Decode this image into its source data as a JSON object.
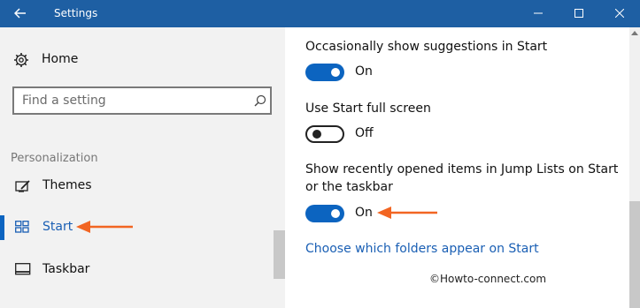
{
  "window": {
    "title": "Settings"
  },
  "nav": {
    "home_label": "Home",
    "search_placeholder": "Find a setting",
    "section_label": "Personalization",
    "items": [
      {
        "label": "Themes",
        "icon": "themes-icon",
        "selected": false
      },
      {
        "label": "Start",
        "icon": "start-icon",
        "selected": true
      },
      {
        "label": "Taskbar",
        "icon": "taskbar-icon",
        "selected": false
      }
    ]
  },
  "settings": [
    {
      "label": "Occasionally show suggestions in Start",
      "state": "On",
      "on": true
    },
    {
      "label": "Use Start full screen",
      "state": "Off",
      "on": false
    },
    {
      "label_line1": "Show recently opened items in Jump Lists on Start",
      "label_line2": "or the taskbar",
      "state": "On",
      "on": true
    }
  ],
  "link": "Choose which folders appear on Start",
  "watermark": "©Howto-connect.com",
  "colors": {
    "titlebar": "#1e5fa3",
    "accent": "#0c64c0",
    "annotation_arrow": "#f26522"
  }
}
